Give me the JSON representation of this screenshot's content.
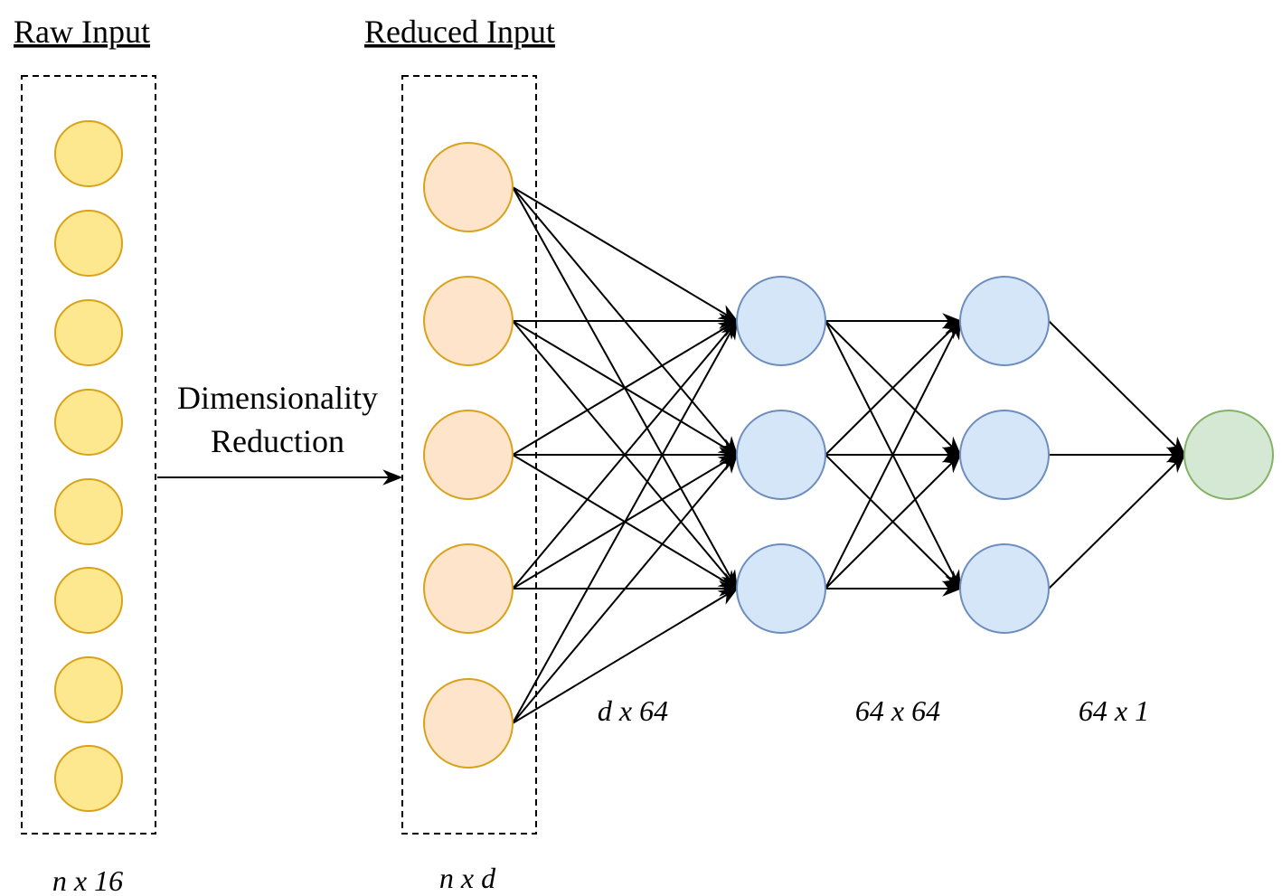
{
  "titles": {
    "raw": "Raw Input",
    "reduced": "Reduced Input"
  },
  "reduction_label": [
    "Dimensionality",
    "Reduction"
  ],
  "dimensions": {
    "raw": "n x 16",
    "reduced": "n x d",
    "layer1": "d x 64",
    "layer2": "64 x 64",
    "layer3": "64 x 1"
  },
  "layers": [
    {
      "name": "raw-input",
      "nodes": 8,
      "fill": "#fee88f",
      "stroke": "#d9a21b"
    },
    {
      "name": "reduced-input",
      "nodes": 5,
      "fill": "#fde4cb",
      "stroke": "#d9a21b"
    },
    {
      "name": "hidden-1",
      "nodes": 3,
      "fill": "#d6e6f9",
      "stroke": "#6c8ebf"
    },
    {
      "name": "hidden-2",
      "nodes": 3,
      "fill": "#d6e6f9",
      "stroke": "#6c8ebf"
    },
    {
      "name": "output",
      "nodes": 1,
      "fill": "#d5e8d4",
      "stroke": "#82b366"
    }
  ]
}
